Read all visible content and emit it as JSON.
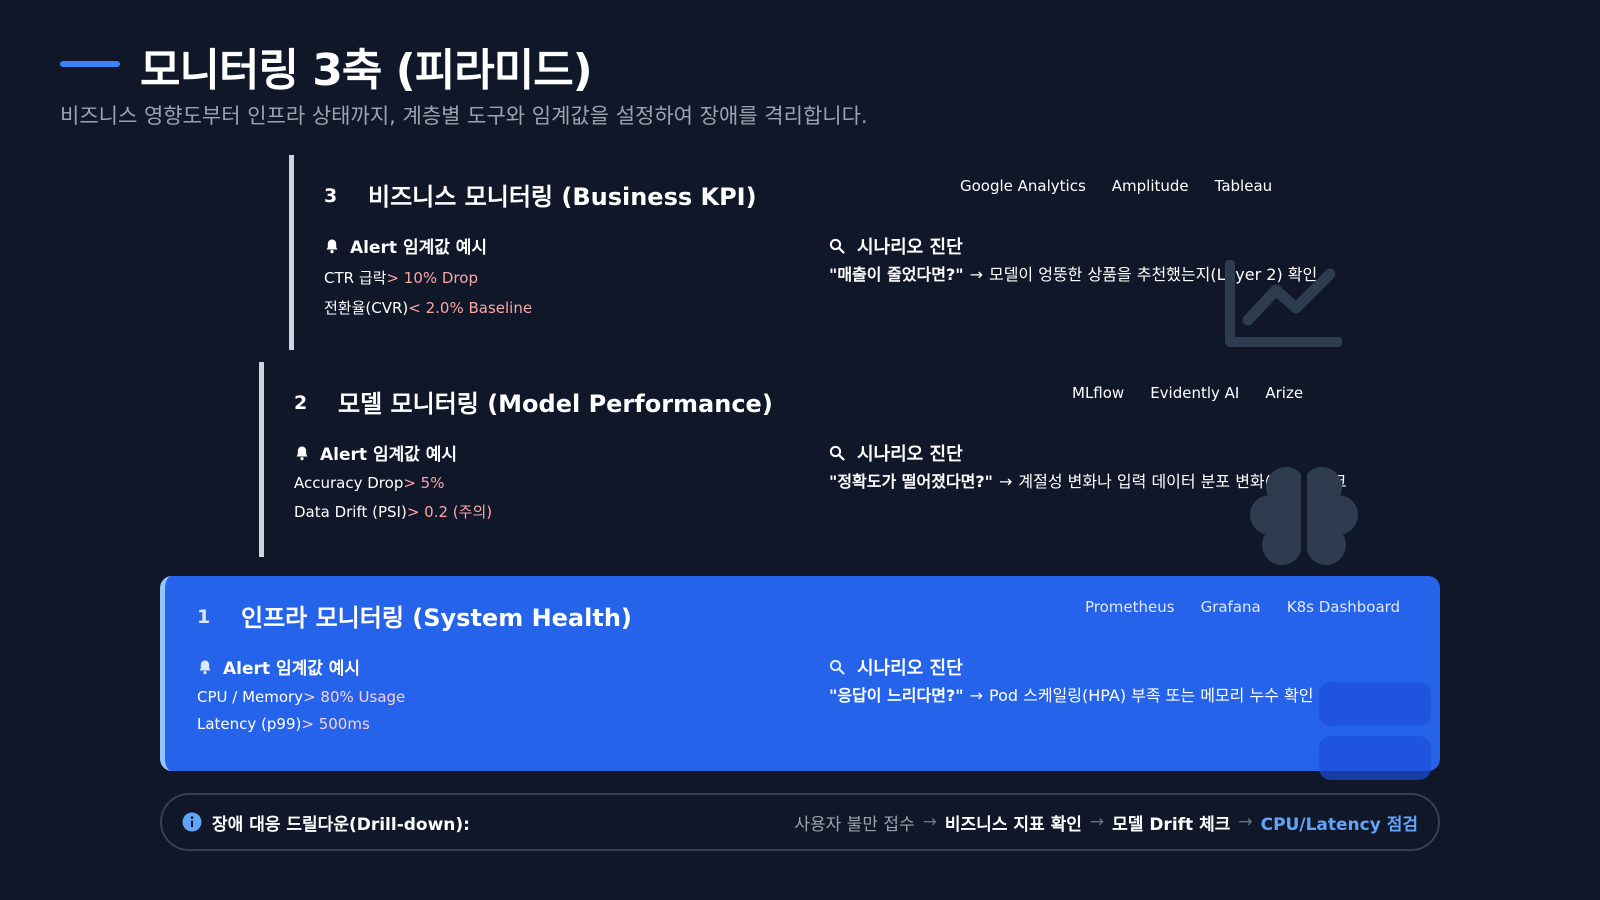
{
  "header": {
    "title": "모니터링 3축 (피라미드)",
    "subtitle": "비즈니스 영향도부터 인프라 상태까지, 계층별 도구와 임계값을 설정하여 장애를 격리합니다."
  },
  "layers": [
    {
      "number": "3",
      "title": "비즈니스 모니터링 (Business KPI)",
      "tools": [
        "Google Analytics",
        "Amplitude",
        "Tableau"
      ],
      "alert_heading": "Alert 임계값 예시",
      "metrics": [
        {
          "name": "CTR 급락",
          "threshold": "> 10% Drop"
        },
        {
          "name": "전환율(CVR)",
          "threshold": "< 2.0% Baseline"
        }
      ],
      "scenario_heading": "시나리오 진단",
      "scenario_question": "\"매출이 줄었다면?\"",
      "scenario_answer": "모델이 엉뚱한 상품을 추천했는지(Layer 2) 확인",
      "deco_icon": "chart-line-icon"
    },
    {
      "number": "2",
      "title": "모델 모니터링 (Model Performance)",
      "tools": [
        "MLflow",
        "Evidently AI",
        "Arize"
      ],
      "alert_heading": "Alert 임계값 예시",
      "metrics": [
        {
          "name": "Accuracy Drop",
          "threshold": "> 5%"
        },
        {
          "name": "Data Drift (PSI)",
          "threshold": "> 0.2 (주의)"
        }
      ],
      "scenario_heading": "시나리오 진단",
      "scenario_question": "\"정확도가 떨어졌다면?\"",
      "scenario_answer": "계절성 변화나 입력 데이터 분포 변화(Drift) 체크",
      "deco_icon": "brain-icon"
    },
    {
      "number": "1",
      "title": "인프라 모니터링 (System Health)",
      "tools": [
        "Prometheus",
        "Grafana",
        "K8s Dashboard"
      ],
      "alert_heading": "Alert 임계값 예시",
      "metrics": [
        {
          "name": "CPU / Memory",
          "threshold": "> 80% Usage"
        },
        {
          "name": "Latency (p99)",
          "threshold": "> 500ms"
        }
      ],
      "scenario_heading": "시나리오 진단",
      "scenario_question": "\"응답이 느리다면?\"",
      "scenario_answer": "Pod 스케일링(HPA) 부족 또는 메모리 누수 확인",
      "deco_icon": "server-icon"
    }
  ],
  "drilldown": {
    "label": "장애 대응 드릴다운(Drill-down):",
    "steps": [
      "사용자 불만 접수",
      "비즈니스 지표 확인",
      "모델 Drift 체크",
      "CPU/Latency 점검"
    ],
    "arrow": "→"
  },
  "colors": {
    "background": "#0f1729",
    "accent": "#3b82f6",
    "highlight_layer": "#2563eb",
    "threshold_text": "#fca5a5",
    "final_step": "#60a5fa"
  }
}
